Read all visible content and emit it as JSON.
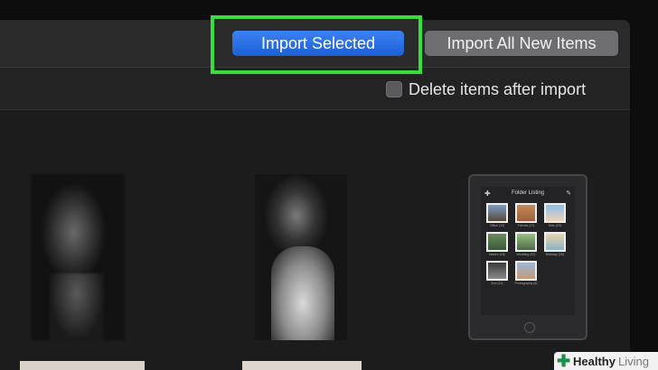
{
  "toolbar": {
    "import_selected_label": "Import Selected",
    "import_all_label": "Import All New Items"
  },
  "options": {
    "delete_after_import_label": "Delete items after import",
    "delete_after_import_checked": false
  },
  "tablet": {
    "title": "Folder Listing",
    "captions": [
      "Office (12)",
      "Friends (17)",
      "Kids (23)",
      "Nature (18)",
      "Wedding (22)",
      "Birthday (15)",
      "Zoo (12)",
      "Photography (6)"
    ]
  },
  "watermark": {
    "brand": "Healthy",
    "suffix": "Living"
  },
  "colors": {
    "highlight": "#36e03a",
    "primary_button": "#2b6fe8",
    "watermark_icon": "#1a8f4a"
  },
  "icons": {
    "watermark": "plus-cross-icon"
  }
}
